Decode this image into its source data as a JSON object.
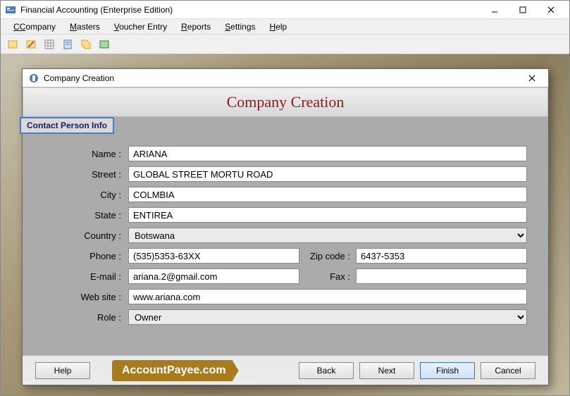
{
  "app": {
    "title": "Financial Accounting (Enterprise Edition)"
  },
  "menu": {
    "company": "Company",
    "masters": "Masters",
    "voucher": "Voucher Entry",
    "reports": "Reports",
    "settings": "Settings",
    "help": "Help"
  },
  "dialog": {
    "window_title": "Company Creation",
    "heading": "Company Creation",
    "tab_label": "Contact Person Info",
    "labels": {
      "name": "Name :",
      "street": "Street :",
      "city": "City :",
      "state": "State :",
      "country": "Country :",
      "phone": "Phone :",
      "zip": "Zip code :",
      "email": "E-mail :",
      "fax": "Fax :",
      "website": "Web site :",
      "role": "Role :"
    },
    "values": {
      "name": "ARIANA",
      "street": "GLOBAL STREET MORTU ROAD",
      "city": "COLMBIA",
      "state": "ENTIREA",
      "country": "Botswana",
      "phone": "(535)5353-63XX",
      "zip": "6437-5353",
      "email": "ariana.2@gmail.com",
      "fax": "",
      "website": "www.ariana.com",
      "role": "Owner"
    },
    "buttons": {
      "help": "Help",
      "back": "Back",
      "next": "Next",
      "finish": "Finish",
      "cancel": "Cancel"
    }
  },
  "badge": "AccountPayee.com"
}
